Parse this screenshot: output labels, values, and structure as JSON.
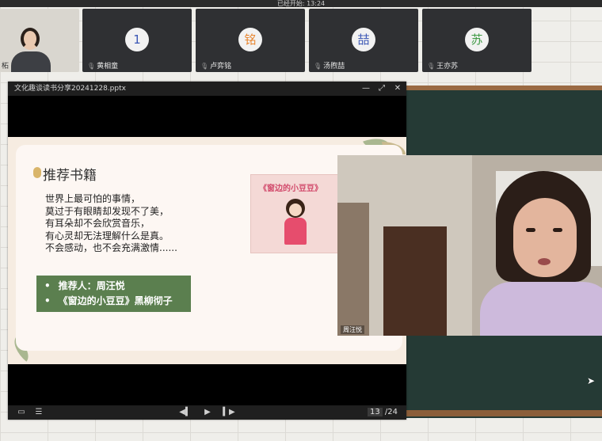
{
  "topbar": {
    "text": "已经开始: 13:24"
  },
  "participants": [
    {
      "name": "柘",
      "type": "camera"
    },
    {
      "name": "黄相童",
      "avatar": "1",
      "avatar_color": "#3b57b5"
    },
    {
      "name": "卢弈铭",
      "avatar": "铭",
      "avatar_color": "#e8852f"
    },
    {
      "name": "汤煦喆",
      "avatar": "喆",
      "avatar_color": "#3b57b5"
    },
    {
      "name": "王亦苏",
      "avatar": "苏",
      "avatar_color": "#3f9a45"
    }
  ],
  "window": {
    "title": "文化趣谈读书分享20241228.pptx",
    "controls": {
      "minimize": "—",
      "restore": "⤢",
      "close": "✕"
    }
  },
  "slide": {
    "title": "推荐书籍",
    "poem": [
      "世界上最可怕的事情，",
      "莫过于有眼睛却发现不了美，",
      "有耳朵却不会欣赏音乐，",
      "有心灵却无法理解什么是真。",
      "不会感动，也不会充满激情......"
    ],
    "recommend": [
      {
        "bullet": "•",
        "text": "推荐人：周汪悦"
      },
      {
        "bullet": "•",
        "text": "《窗边的小豆豆》黑柳彻子"
      }
    ],
    "book_cover_title": "《窗边的小豆豆》"
  },
  "webcam": {
    "label": "周汪悦"
  },
  "toolbar": {
    "current_page": "13",
    "total_pages": "/24"
  }
}
